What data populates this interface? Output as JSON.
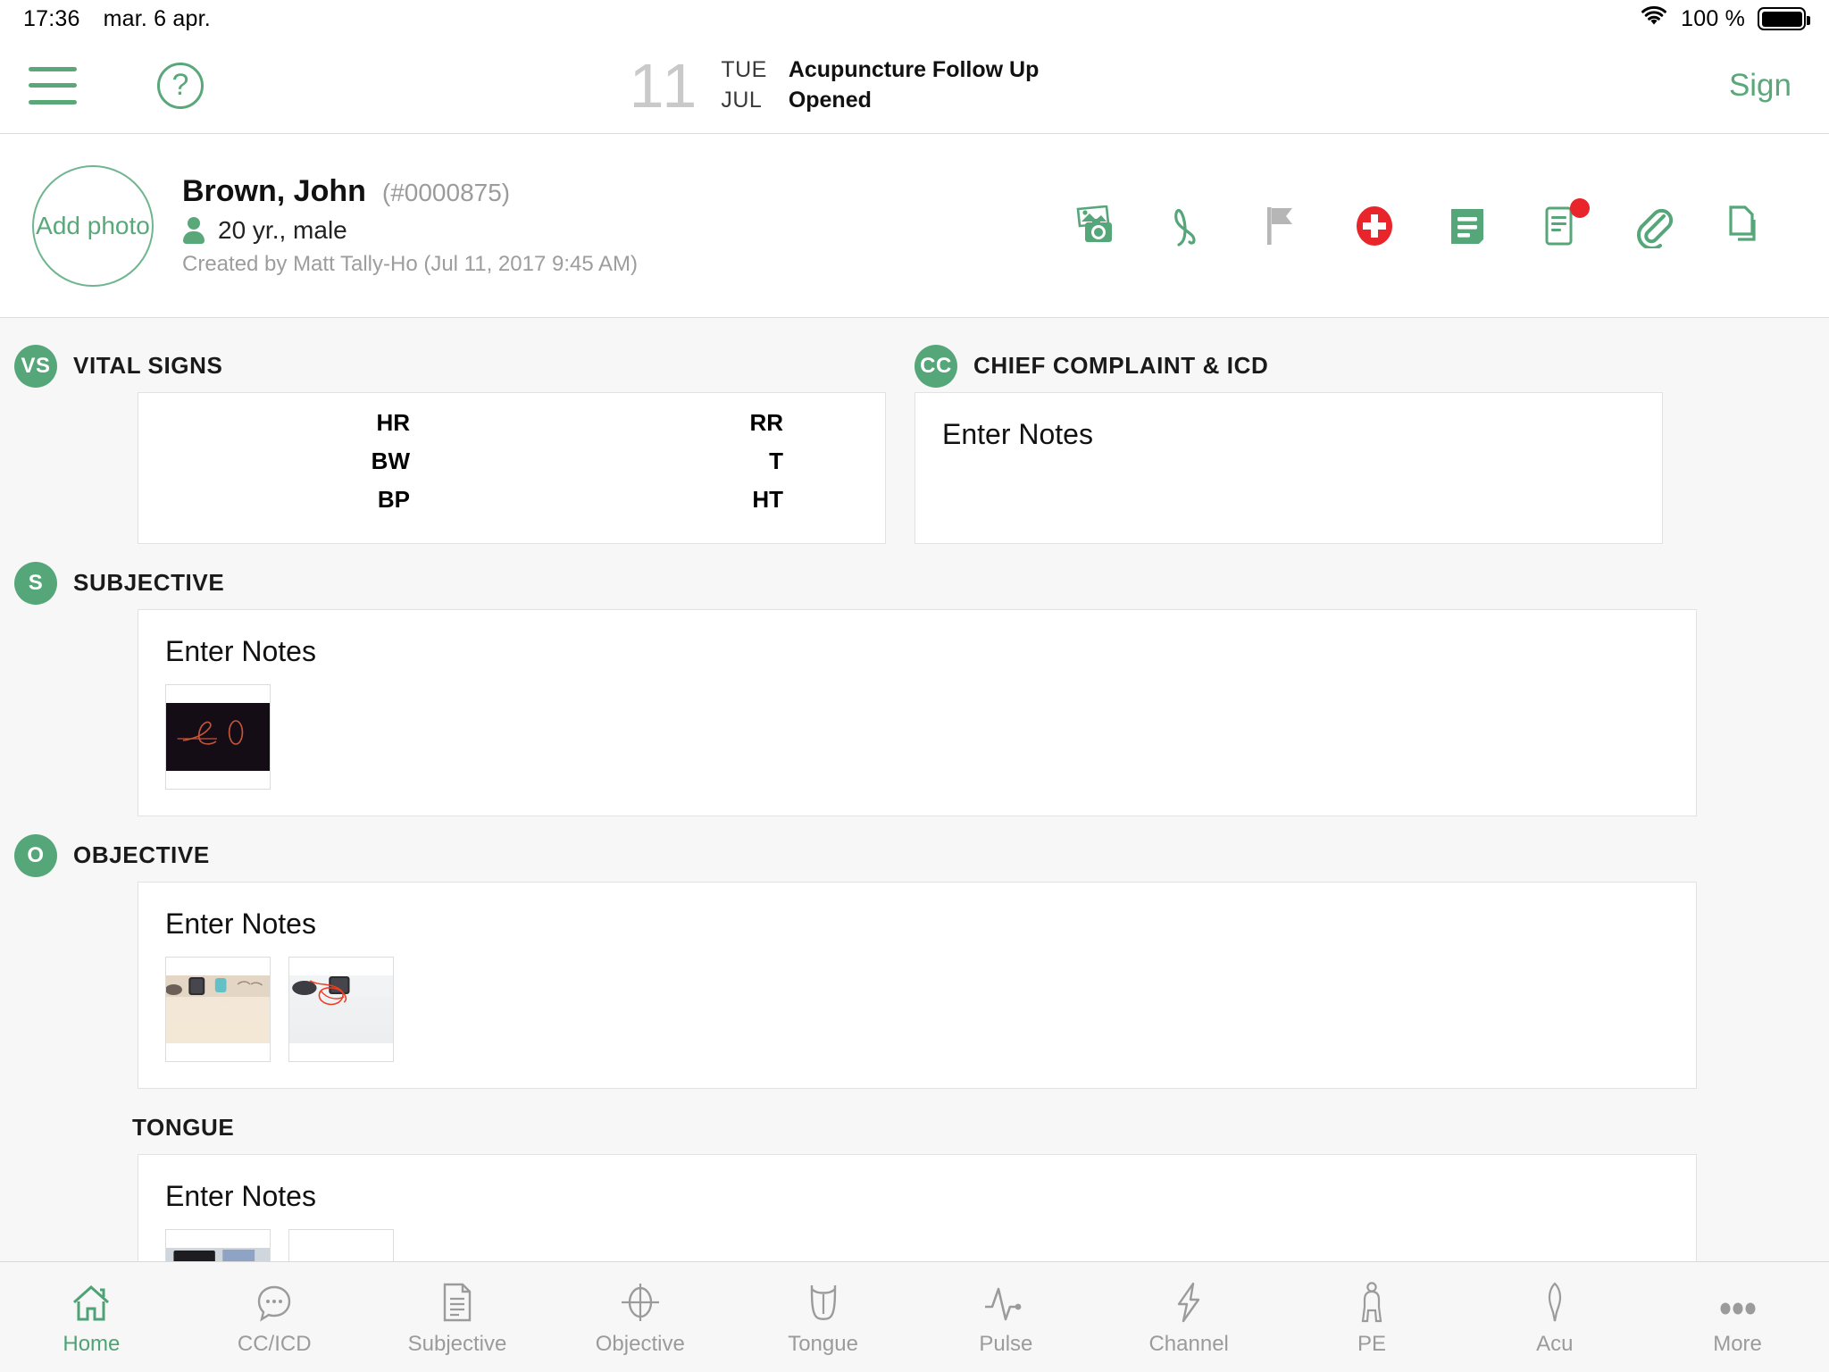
{
  "statusbar": {
    "time": "17:36",
    "date": "mar. 6 apr.",
    "battery_pct": "100 %",
    "wifi_icon": "wifi-icon",
    "battery_icon": "battery-full-icon"
  },
  "topnav": {
    "menu_icon": "hamburger-menu-icon",
    "help_icon": "help-question-icon",
    "help_label": "?",
    "appointment": {
      "day": "11",
      "dow": "TUE",
      "month": "JUL",
      "type": "Acupuncture Follow Up",
      "status": "Opened"
    },
    "sign_label": "Sign"
  },
  "patient": {
    "avatar_label": "Add photo",
    "name": "Brown, John",
    "chart_id": "(#0000875)",
    "demographics": "20 yr., male",
    "created_by": "Created by Matt Tally-Ho (Jul 11, 2017  9:45 AM)",
    "tools": [
      {
        "name": "photo-camera-icon",
        "color": "#55a678"
      },
      {
        "name": "handwriting-signature-icon",
        "color": "#55a678"
      },
      {
        "name": "flag-icon",
        "color": "#b6b6b6"
      },
      {
        "name": "medical-cross-icon",
        "color": "#e8252a"
      },
      {
        "name": "note-document-icon",
        "color": "#55a678"
      },
      {
        "name": "form-alert-icon",
        "color": "#55a678",
        "badge": true
      },
      {
        "name": "paperclip-attachment-icon",
        "color": "#55a678"
      },
      {
        "name": "copy-documents-icon",
        "color": "#55a678"
      }
    ]
  },
  "sections": {
    "vital_signs": {
      "badge": "VS",
      "title": "VITAL SIGNS",
      "fields": [
        {
          "left": "HR",
          "right": "RR"
        },
        {
          "left": "BW",
          "right": "T"
        },
        {
          "left": "BP",
          "right": "HT"
        }
      ]
    },
    "chief_complaint": {
      "badge": "CC",
      "title": "CHIEF COMPLAINT & ICD",
      "placeholder": "Enter Notes"
    },
    "subjective": {
      "badge": "S",
      "title": "SUBJECTIVE",
      "placeholder": "Enter Notes",
      "thumbs": [
        {
          "name": "signature-drawing-thumbnail",
          "style": "th-sign"
        }
      ]
    },
    "objective": {
      "badge": "O",
      "title": "OBJECTIVE",
      "placeholder": "Enter Notes",
      "thumbs": [
        {
          "name": "desk-photo-thumbnail",
          "style": "th-desk1"
        },
        {
          "name": "annotated-desk-photo-thumbnail",
          "style": "th-desk2"
        }
      ]
    },
    "tongue": {
      "badge": "",
      "title": "TONGUE",
      "placeholder": "Enter Notes",
      "thumbs": [
        {
          "name": "monitor-desk-photo-thumbnail",
          "style": "th-desk3"
        },
        {
          "name": "red-sketch-thumbnail",
          "style": "th-white"
        }
      ]
    }
  },
  "tabbar": {
    "items": [
      {
        "label": "Home",
        "icon": "home-icon",
        "active": true
      },
      {
        "label": "CC/ICD",
        "icon": "speech-bubble-icon",
        "active": false
      },
      {
        "label": "Subjective",
        "icon": "document-lines-icon",
        "active": false
      },
      {
        "label": "Objective",
        "icon": "target-crosshair-icon",
        "active": false
      },
      {
        "label": "Tongue",
        "icon": "tongue-icon",
        "active": false
      },
      {
        "label": "Pulse",
        "icon": "pulse-wave-icon",
        "active": false
      },
      {
        "label": "Channel",
        "icon": "lightning-bolt-icon",
        "active": false
      },
      {
        "label": "PE",
        "icon": "body-figure-icon",
        "active": false
      },
      {
        "label": "Acu",
        "icon": "acupuncture-needle-icon",
        "active": false
      },
      {
        "label": "More",
        "icon": "more-dots-icon",
        "active": false
      }
    ]
  },
  "colors": {
    "accent_green": "#55a678",
    "alert_red": "#e8252a",
    "muted_gray": "#9b9b9b",
    "page_bg": "#f7f7f7"
  }
}
